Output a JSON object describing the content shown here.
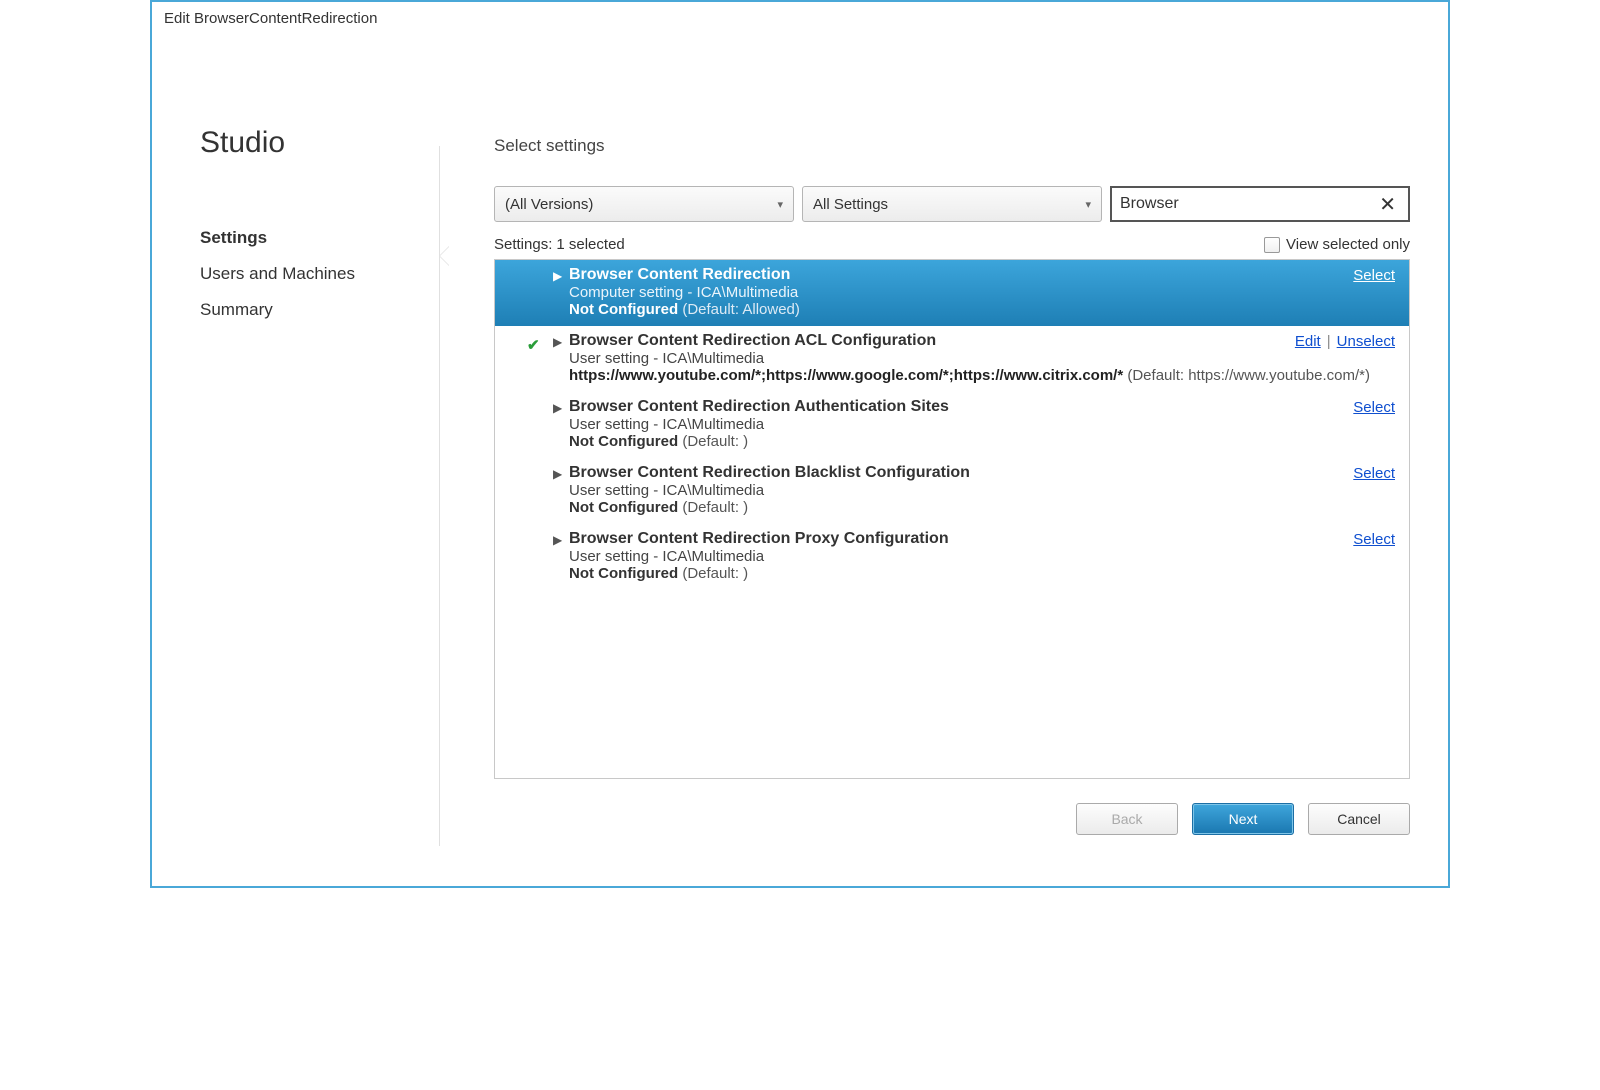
{
  "window": {
    "title": "Edit BrowserContentRedirection"
  },
  "sidebar": {
    "title": "Studio",
    "items": [
      {
        "label": "Settings",
        "active": true
      },
      {
        "label": "Users and Machines",
        "active": false
      },
      {
        "label": "Summary",
        "active": false
      }
    ]
  },
  "main": {
    "section_title": "Select settings",
    "dropdown_versions": "(All Versions)",
    "dropdown_scope": "All Settings",
    "search_value": "Browser",
    "summary_label": "Settings:",
    "summary_count": "1 selected",
    "view_selected_only": "View selected only"
  },
  "settings": [
    {
      "title": "Browser Content Redirection",
      "sub": "Computer setting - ICA\\Multimedia",
      "state_label": "Not Configured",
      "state_default": " (Default: Allowed)",
      "highlight": true,
      "checked": false,
      "actions": [
        {
          "label": "Select"
        }
      ]
    },
    {
      "title": "Browser Content Redirection ACL Configuration",
      "sub": "User setting - ICA\\Multimedia",
      "value": "https://www.youtube.com/*;https://www.google.com/*;https://www.citrix.com/*",
      "value_default": " (Default: https://www.youtube.com/*)",
      "highlight": false,
      "checked": true,
      "actions": [
        {
          "label": "Edit"
        },
        {
          "label": "Unselect"
        }
      ]
    },
    {
      "title": "Browser Content Redirection Authentication Sites",
      "sub": "User setting - ICA\\Multimedia",
      "state_label": "Not Configured",
      "state_default": " (Default: )",
      "highlight": false,
      "checked": false,
      "actions": [
        {
          "label": "Select"
        }
      ]
    },
    {
      "title": "Browser Content Redirection Blacklist Configuration",
      "sub": "User setting - ICA\\Multimedia",
      "state_label": "Not Configured",
      "state_default": " (Default: )",
      "highlight": false,
      "checked": false,
      "actions": [
        {
          "label": "Select"
        }
      ]
    },
    {
      "title": "Browser Content Redirection Proxy Configuration",
      "sub": "User setting - ICA\\Multimedia",
      "state_label": "Not Configured",
      "state_default": " (Default: )",
      "highlight": false,
      "checked": false,
      "actions": [
        {
          "label": "Select"
        }
      ]
    }
  ],
  "footer": {
    "back": "Back",
    "next": "Next",
    "cancel": "Cancel"
  }
}
